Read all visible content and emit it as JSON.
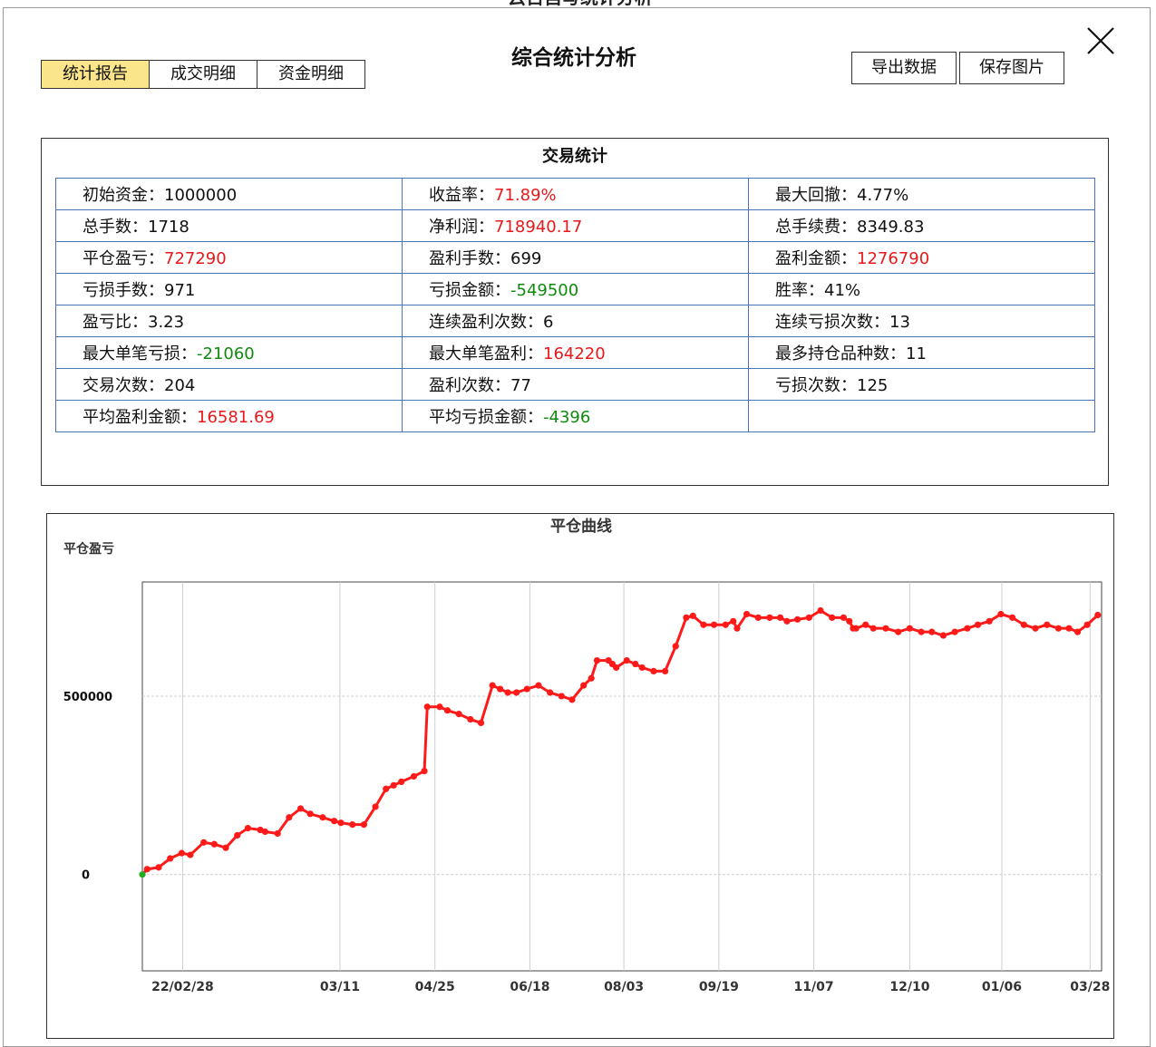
{
  "background_title": "云百自写统计分析",
  "dialog": {
    "title": "综合统计分析",
    "tabs": [
      {
        "label": "统计报告",
        "active": true
      },
      {
        "label": "成交明细",
        "active": false
      },
      {
        "label": "资金明细",
        "active": false
      }
    ],
    "buttons": {
      "export": "导出数据",
      "save_image": "保存图片"
    },
    "close_icon": "close-icon"
  },
  "stats": {
    "title": "交易统计",
    "rows": [
      [
        {
          "label": "初始资金：",
          "value": "1000000",
          "color": "default"
        },
        {
          "label": "收益率：",
          "value": "71.89%",
          "color": "red"
        },
        {
          "label": "最大回撤：",
          "value": "4.77%",
          "color": "default"
        }
      ],
      [
        {
          "label": "总手数：",
          "value": "1718",
          "color": "default"
        },
        {
          "label": "净利润：",
          "value": "718940.17",
          "color": "red"
        },
        {
          "label": "总手续费：",
          "value": "8349.83",
          "color": "default"
        }
      ],
      [
        {
          "label": "平仓盈亏：",
          "value": "727290",
          "color": "red"
        },
        {
          "label": "盈利手数：",
          "value": "699",
          "color": "default"
        },
        {
          "label": "盈利金额：",
          "value": "1276790",
          "color": "red"
        }
      ],
      [
        {
          "label": "亏损手数：",
          "value": "971",
          "color": "default"
        },
        {
          "label": "亏损金额：",
          "value": "-549500",
          "color": "green"
        },
        {
          "label": "胜率：",
          "value": "41%",
          "color": "default"
        }
      ],
      [
        {
          "label": "盈亏比：",
          "value": "3.23",
          "color": "default"
        },
        {
          "label": "连续盈利次数：",
          "value": "6",
          "color": "default"
        },
        {
          "label": "连续亏损次数：",
          "value": "13",
          "color": "default"
        }
      ],
      [
        {
          "label": "最大单笔亏损：",
          "value": "-21060",
          "color": "green"
        },
        {
          "label": "最大单笔盈利：",
          "value": "164220",
          "color": "red"
        },
        {
          "label": "最多持仓品种数：",
          "value": "11",
          "color": "default"
        }
      ],
      [
        {
          "label": "交易次数：",
          "value": "204",
          "color": "default"
        },
        {
          "label": "盈利次数：",
          "value": "77",
          "color": "default"
        },
        {
          "label": "亏损次数：",
          "value": "125",
          "color": "default"
        }
      ],
      [
        {
          "label": "平均盈利金额：",
          "value": "16581.69",
          "color": "red"
        },
        {
          "label": "平均亏损金额：",
          "value": "-4396",
          "color": "green"
        },
        {
          "label": "",
          "value": "",
          "color": "default"
        }
      ]
    ]
  },
  "colors": {
    "red": "#e8191b",
    "green": "#0f8a0f",
    "active_tab": "#fbe58a",
    "table_border": "#4a72b8",
    "line": "#ff1a1a",
    "start_point": "#22aa22"
  },
  "chart_data": {
    "type": "line",
    "title": "平仓曲线",
    "ylabel": "平仓盈亏",
    "xlabel": "",
    "x_tick_labels": [
      "22/02/28",
      "03/11",
      "04/25",
      "06/18",
      "08/03",
      "09/19",
      "11/07",
      "12/10",
      "01/06",
      "03/28"
    ],
    "y_ticks": [
      0,
      500000
    ],
    "ylim": [
      -270000,
      820000
    ],
    "grid": true,
    "series": [
      {
        "x": [
          0.0,
          0.005,
          0.017,
          0.029,
          0.041,
          0.05,
          0.064,
          0.075,
          0.087,
          0.099,
          0.11,
          0.123,
          0.128,
          0.141,
          0.153,
          0.165,
          0.175,
          0.188,
          0.2,
          0.207,
          0.219,
          0.231,
          0.243,
          0.254,
          0.262,
          0.27,
          0.283,
          0.294,
          0.297,
          0.31,
          0.318,
          0.33,
          0.342,
          0.353,
          0.365,
          0.373,
          0.381,
          0.39,
          0.401,
          0.413,
          0.425,
          0.437,
          0.448,
          0.46,
          0.468,
          0.474,
          0.486,
          0.49,
          0.494,
          0.505,
          0.514,
          0.521,
          0.533,
          0.545,
          0.556,
          0.567,
          0.574,
          0.585,
          0.596,
          0.608,
          0.616,
          0.62,
          0.63,
          0.642,
          0.654,
          0.665,
          0.672,
          0.683,
          0.695,
          0.707,
          0.719,
          0.731,
          0.737,
          0.741,
          0.744,
          0.754,
          0.762,
          0.775,
          0.788,
          0.8,
          0.812,
          0.823,
          0.835,
          0.847,
          0.86,
          0.871,
          0.883,
          0.895,
          0.907,
          0.919,
          0.931,
          0.943,
          0.955,
          0.966,
          0.975,
          0.985,
          0.996
        ],
        "y": [
          0,
          15000,
          20000,
          45000,
          60000,
          55000,
          90000,
          85000,
          75000,
          110000,
          130000,
          125000,
          120000,
          115000,
          160000,
          185000,
          170000,
          160000,
          150000,
          145000,
          140000,
          140000,
          190000,
          240000,
          250000,
          260000,
          275000,
          290000,
          470000,
          470000,
          460000,
          450000,
          435000,
          425000,
          530000,
          520000,
          510000,
          510000,
          520000,
          530000,
          510000,
          500000,
          490000,
          530000,
          550000,
          600000,
          600000,
          590000,
          580000,
          600000,
          590000,
          580000,
          570000,
          570000,
          640000,
          720000,
          725000,
          700000,
          700000,
          700000,
          710000,
          690000,
          730000,
          720000,
          720000,
          720000,
          710000,
          715000,
          720000,
          740000,
          720000,
          720000,
          710000,
          690000,
          690000,
          700000,
          690000,
          690000,
          680000,
          690000,
          680000,
          680000,
          670000,
          680000,
          690000,
          700000,
          710000,
          730000,
          720000,
          700000,
          690000,
          700000,
          690000,
          690000,
          680000,
          700000,
          727290
        ]
      }
    ]
  }
}
